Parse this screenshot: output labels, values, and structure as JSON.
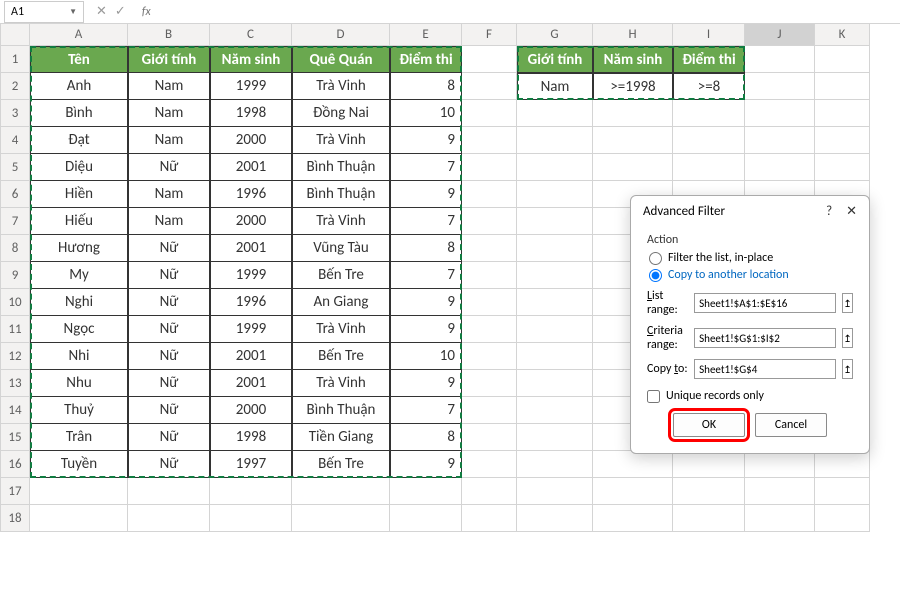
{
  "name_box": "A1",
  "formula": "",
  "columns": [
    "A",
    "B",
    "C",
    "D",
    "E",
    "F",
    "G",
    "H",
    "I",
    "J",
    "K"
  ],
  "headers": {
    "A": "Tên",
    "B": "Giới tính",
    "C": "Năm sinh",
    "D": "Quê Quán",
    "E": "Điểm thi"
  },
  "crit_headers": {
    "G": "Giới tính",
    "H": "Năm sinh",
    "I": "Điểm thi"
  },
  "crit_vals": {
    "G": "Nam",
    "H": ">=1998",
    "I": ">=8"
  },
  "rows": [
    {
      "A": "Anh",
      "B": "Nam",
      "C": "1999",
      "D": "Trà Vinh",
      "E": "8"
    },
    {
      "A": "Bình",
      "B": "Nam",
      "C": "1998",
      "D": "Đồng Nai",
      "E": "10"
    },
    {
      "A": "Đạt",
      "B": "Nam",
      "C": "2000",
      "D": "Trà Vinh",
      "E": "9"
    },
    {
      "A": "Diệu",
      "B": "Nữ",
      "C": "2001",
      "D": "Bình Thuận",
      "E": "7"
    },
    {
      "A": "Hiền",
      "B": "Nam",
      "C": "1996",
      "D": "Bình Thuận",
      "E": "9"
    },
    {
      "A": "Hiếu",
      "B": "Nam",
      "C": "2000",
      "D": "Trà Vinh",
      "E": "7"
    },
    {
      "A": "Hương",
      "B": "Nữ",
      "C": "2001",
      "D": "Vũng Tàu",
      "E": "8"
    },
    {
      "A": "My",
      "B": "Nữ",
      "C": "1999",
      "D": "Bến Tre",
      "E": "7"
    },
    {
      "A": "Nghi",
      "B": "Nữ",
      "C": "1996",
      "D": "An Giang",
      "E": "9"
    },
    {
      "A": "Ngọc",
      "B": "Nữ",
      "C": "1999",
      "D": "Trà Vinh",
      "E": "9"
    },
    {
      "A": "Nhi",
      "B": "Nữ",
      "C": "2001",
      "D": "Bến Tre",
      "E": "10"
    },
    {
      "A": "Nhu",
      "B": "Nữ",
      "C": "2001",
      "D": "Trà Vinh",
      "E": "9"
    },
    {
      "A": "Thuỷ",
      "B": "Nữ",
      "C": "2000",
      "D": "Bình Thuận",
      "E": "7"
    },
    {
      "A": "Trân",
      "B": "Nữ",
      "C": "1998",
      "D": "Tiền Giang",
      "E": "8"
    },
    {
      "A": "Tuyền",
      "B": "Nữ",
      "C": "1997",
      "D": "Bến Tre",
      "E": "9"
    }
  ],
  "dialog": {
    "title": "Advanced Filter",
    "action_label": "Action",
    "opt1": "Filter the list, in-place",
    "opt2": "Copy to another location",
    "list_label": "List range:",
    "list_val": "Sheet1!$A$1:$E$16",
    "crit_label": "Criteria range:",
    "crit_val": "Sheet1!$G$1:$I$2",
    "copy_label": "Copy to:",
    "copy_val": "Sheet1!$G$4",
    "unique": "Unique records only",
    "ok": "OK",
    "cancel": "Cancel"
  }
}
